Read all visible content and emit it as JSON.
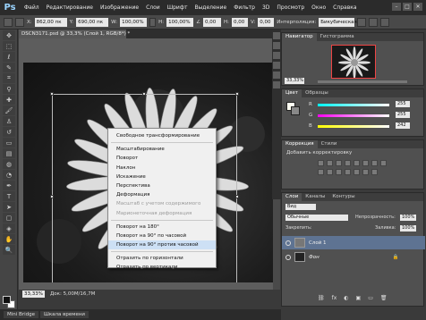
{
  "app": {
    "logo": "Ps"
  },
  "menu": [
    "Файл",
    "Редактирование",
    "Изображение",
    "Слои",
    "Шрифт",
    "Выделение",
    "Фильтр",
    "3D",
    "Просмотр",
    "Окно",
    "Справка"
  ],
  "window_controls": [
    "–",
    "□",
    "✕"
  ],
  "options_bar": {
    "x_value": "862,00 пк",
    "y_value": "690,00 пк",
    "w_value": "100,00%",
    "h_value": "100,00%",
    "angle_value": "0,00",
    "h_skew": "0,00",
    "v_skew": "0,00",
    "interpolation_label": "Интерполяция:",
    "interpolation_value": "Бикубическая"
  },
  "document": {
    "tab_title": "DSCN3171.psd @ 33,3% (Слой 1, RGB/8*) *",
    "zoom": "33,33%",
    "doc_info": "Док: 5,00M/16,7M"
  },
  "context_menu": {
    "items": [
      {
        "label": "Свободное трансформирование",
        "disabled": false,
        "highlighted": false,
        "sep_after": true
      },
      {
        "label": "Масштабирование",
        "disabled": false,
        "highlighted": false,
        "sep_after": false
      },
      {
        "label": "Поворот",
        "disabled": false,
        "highlighted": false,
        "sep_after": false
      },
      {
        "label": "Наклон",
        "disabled": false,
        "highlighted": false,
        "sep_after": false
      },
      {
        "label": "Искажение",
        "disabled": false,
        "highlighted": false,
        "sep_after": false
      },
      {
        "label": "Перспектива",
        "disabled": false,
        "highlighted": false,
        "sep_after": false
      },
      {
        "label": "Деформация",
        "disabled": false,
        "highlighted": false,
        "sep_after": false
      },
      {
        "label": "Масштаб с учетом содержимого",
        "disabled": true,
        "highlighted": false,
        "sep_after": false
      },
      {
        "label": "Марионеточная деформация",
        "disabled": true,
        "highlighted": false,
        "sep_after": true
      },
      {
        "label": "Поворот на 180°",
        "disabled": false,
        "highlighted": false,
        "sep_after": false
      },
      {
        "label": "Поворот на 90° по часовой",
        "disabled": false,
        "highlighted": false,
        "sep_after": false
      },
      {
        "label": "Поворот на 90° против часовой",
        "disabled": false,
        "highlighted": true,
        "sep_after": true
      },
      {
        "label": "Отразить по горизонтали",
        "disabled": false,
        "highlighted": false,
        "sep_after": false
      },
      {
        "label": "Отразить по вертикали",
        "disabled": false,
        "highlighted": false,
        "sep_after": false
      }
    ]
  },
  "navigator": {
    "tabs": [
      "Навигатор",
      "Гистограмма"
    ],
    "zoom": "33,33%"
  },
  "color_panel": {
    "tabs": [
      "Цвет",
      "Образцы"
    ],
    "channels": [
      {
        "label": "R",
        "value": "255"
      },
      {
        "label": "G",
        "value": "255"
      },
      {
        "label": "B",
        "value": "242"
      }
    ]
  },
  "adjustments": {
    "tabs": [
      "Коррекция",
      "Стили"
    ],
    "title": "Добавить корректировку"
  },
  "layers_panel": {
    "tabs": [
      "Слои",
      "Каналы",
      "Контуры"
    ],
    "kind_label": "Вид",
    "blend_mode": "Обычные",
    "opacity_label": "Непрозрачность:",
    "opacity_value": "100%",
    "lock_label": "Закрепить:",
    "fill_label": "Заливка:",
    "fill_value": "100%",
    "layers": [
      {
        "name": "Слой 1",
        "italic": false
      },
      {
        "name": "Фон",
        "italic": true
      }
    ],
    "footer_icons": [
      "⛓",
      "fx",
      "◐",
      "▣",
      "▭",
      "🗑"
    ]
  },
  "bottom_tabs": [
    "Mini Bridge",
    "Шкала времени"
  ]
}
